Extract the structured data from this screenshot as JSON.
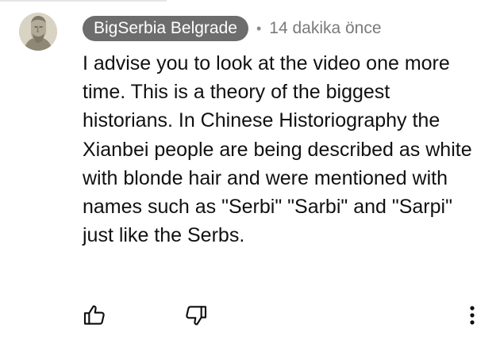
{
  "comment": {
    "author": "BigSerbia Belgrade",
    "separator": "•",
    "timestamp": "14 dakika önce",
    "text": "I advise you to look at the video one more time. This is a theory of the biggest historians. In Chinese Historiography the Xianbei people are being described as white with blonde hair and were mentioned with names such as \"Serbi\" \"Sarbi\" and \"Sarpi\" just like the Serbs."
  },
  "icons": {
    "avatar": "bust-statue-avatar",
    "like": "thumbs-up-icon",
    "dislike": "thumbs-down-icon",
    "more": "vertical-ellipsis-icon"
  },
  "colors": {
    "author_chip_bg": "#6d6d6d",
    "author_chip_text": "#ffffff",
    "timestamp": "#7a7a7a",
    "body_text": "#111111"
  }
}
